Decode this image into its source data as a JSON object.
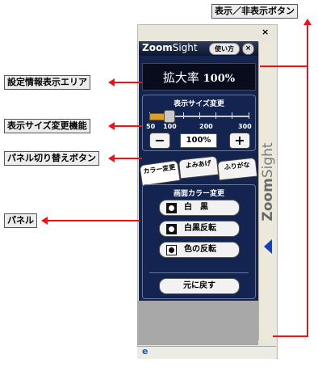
{
  "callouts": {
    "toggle_button": "表示／非表示ボタン",
    "settings_info_area": "設定情報表示エリア",
    "size_change_feature": "表示サイズ変更機能",
    "panel_switch_button": "パネル切り替えボタン",
    "panel": "パネル"
  },
  "window": {
    "close_label": "×",
    "status_icon": "e"
  },
  "panel": {
    "logo_prefix": "Zoom",
    "logo_suffix": "Sight",
    "help_label": "使い方",
    "close_label": "×",
    "info": {
      "label": "拡大率",
      "value": "100%"
    },
    "size": {
      "title": "表示サイズ変更",
      "tick_labels": [
        "50",
        "100",
        "200",
        "300"
      ],
      "minus_label": "−",
      "plus_label": "+",
      "zoom_value": "100%",
      "slider_value_percent": 100
    },
    "tabs": [
      {
        "label": "カラー変更",
        "active": true
      },
      {
        "label": "よみあげ",
        "active": false
      },
      {
        "label": "ふりがな",
        "active": false
      }
    ],
    "color_panel": {
      "title": "画面カラー変更",
      "buttons": [
        "白　黒",
        "白黒反転",
        "色の反転"
      ],
      "reset_label": "元に戻す"
    }
  },
  "sidebar": {
    "text_prefix": "Zoom",
    "text_suffix": "Sight"
  },
  "colors": {
    "accent_red": "#e8141a",
    "panel_navy": "#12244f",
    "toggle_blue": "#1a3fb5"
  }
}
